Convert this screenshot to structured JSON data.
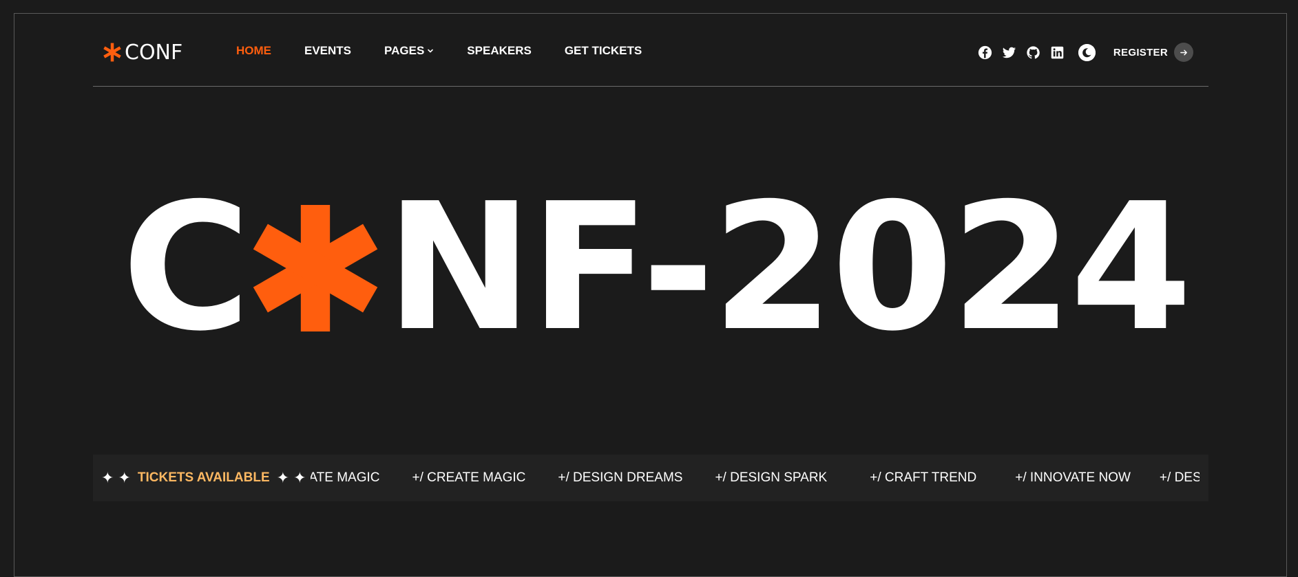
{
  "brand": {
    "name": "CONF",
    "accent_color": "#ff5e0e"
  },
  "nav": {
    "items": [
      {
        "label": "HOME",
        "active": true
      },
      {
        "label": "EVENTS",
        "active": false
      },
      {
        "label": "PAGES",
        "active": false,
        "has_dropdown": true
      },
      {
        "label": "SPEAKERS",
        "active": false
      },
      {
        "label": "GET TICKETS",
        "active": false
      }
    ]
  },
  "social": [
    {
      "icon": "facebook-icon"
    },
    {
      "icon": "twitter-icon"
    },
    {
      "icon": "github-icon"
    },
    {
      "icon": "linkedin-icon"
    }
  ],
  "header": {
    "theme_toggle_icon": "moon-icon",
    "register_label": "REGISTER"
  },
  "hero": {
    "text_before_star": "C",
    "text_after_star": "NF-2024"
  },
  "ticker": {
    "badge_label": "TICKETS AVAILABLE",
    "badge_color": "#fdb862",
    "items": [
      "REATE MAGIC",
      "+/ CREATE MAGIC",
      "+/ DESIGN DREAMS",
      "+/ DESIGN SPARK",
      "+/ CRAFT TREND",
      "+/ INNOVATE NOW",
      "+/ DESIGN DREAMS"
    ]
  }
}
